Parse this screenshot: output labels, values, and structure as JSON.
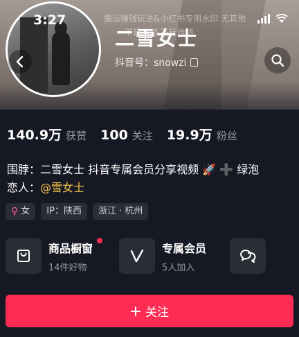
{
  "status_bar": {
    "time": "3:27"
  },
  "banner": {
    "watermark_line1": "搬运赚钱玩法&小红书专用水印 无其他",
    "watermark_line2": "不玩推特 不玩推特"
  },
  "profile": {
    "nickname": "二雪女士",
    "douyin_id": "抖音号：snowzi"
  },
  "stats": [
    {
      "num": "140.9万",
      "label": "获赞"
    },
    {
      "num": "100",
      "label": "关注"
    },
    {
      "num": "19.9万",
      "label": "粉丝"
    }
  ],
  "bio": {
    "line1": "围脖：二雪女士  抖音专属会员分享视频 🚀 ➕ 绿泡",
    "line2_prefix": "恋人：",
    "line2_mention": "@雪女士"
  },
  "tags": {
    "gender": "女",
    "ip": "IP：陕西",
    "location": "浙江 · 杭州"
  },
  "features": [
    {
      "title": "商品橱窗",
      "subtitle": "14件好物",
      "icon": "shopping-bag-icon"
    },
    {
      "title": "专属会员",
      "subtitle": "5人加入",
      "icon": "v-member-icon"
    },
    {
      "icon": "chat-bubbles-icon"
    }
  ],
  "follow_button": {
    "label": "关注",
    "color": "#fe2c55"
  },
  "colors": {
    "background": "#161823",
    "accent": "#fe2c55",
    "mention": "#f6c54a"
  }
}
